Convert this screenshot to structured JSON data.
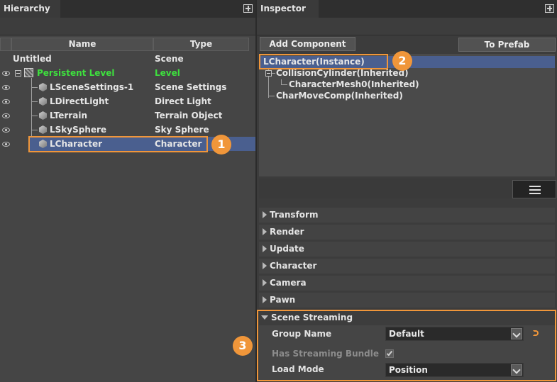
{
  "hierarchy": {
    "title": "Hierarchy",
    "columns": {
      "name": "Name",
      "type": "Type"
    },
    "rows": [
      {
        "name": "Untitled",
        "type": "Scene"
      },
      {
        "name": "Persistent Level",
        "type": "Level"
      },
      {
        "name": "LSceneSettings-1",
        "type": "Scene Settings"
      },
      {
        "name": "LDirectLight",
        "type": "Direct Light"
      },
      {
        "name": "LTerrain",
        "type": "Terrain Object"
      },
      {
        "name": "LSkySphere",
        "type": "Sky Sphere"
      },
      {
        "name": "LCharacter",
        "type": "Character"
      }
    ]
  },
  "inspector": {
    "title": "Inspector",
    "add_component": "Add Component",
    "to_prefab": "To Prefab",
    "components": [
      "LCharacter(Instance)",
      "CollisionCylinder(Inherited)",
      "CharacterMesh0(Inherited)",
      "CharMoveComp(Inherited)"
    ],
    "sections": [
      "Transform",
      "Render",
      "Update",
      "Character",
      "Camera",
      "Pawn"
    ],
    "scene_streaming": {
      "title": "Scene Streaming",
      "group_name_label": "Group Name",
      "group_name_value": "Default",
      "has_bundle_label": "Has Streaming Bundle",
      "load_mode_label": "Load Mode",
      "load_mode_value": "Position"
    }
  },
  "callouts": [
    "1",
    "2",
    "3"
  ],
  "colors": {
    "accent": "#f0963a",
    "selection": "#4a5f8f",
    "level_green": "#3ee03e"
  }
}
